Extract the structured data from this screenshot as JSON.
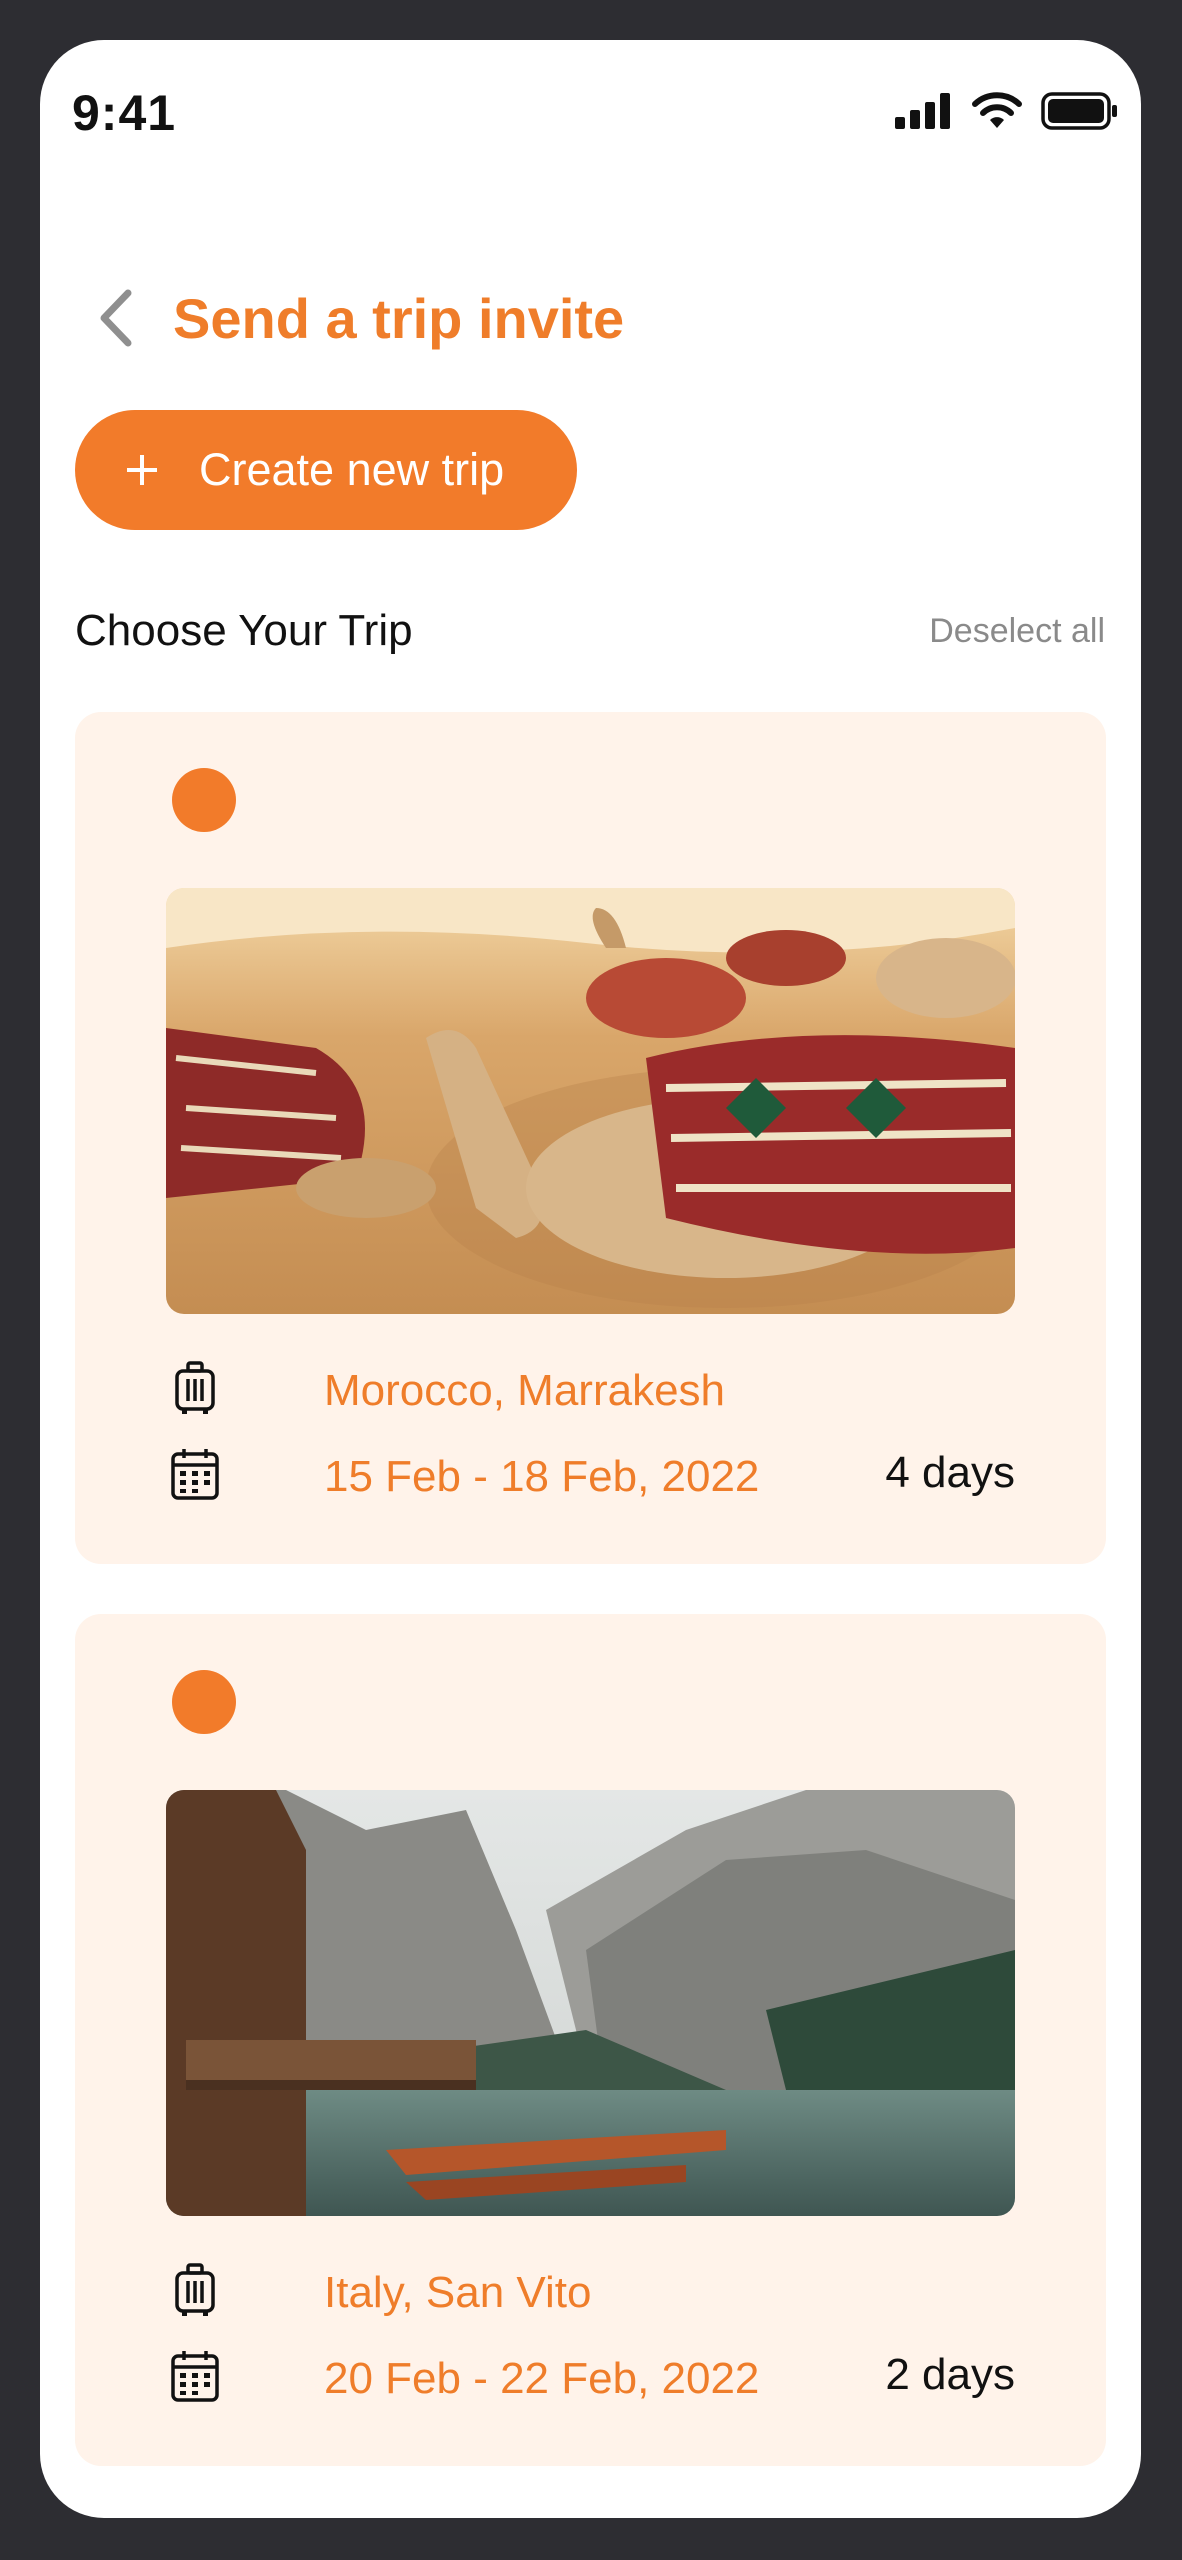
{
  "status_bar": {
    "time": "9:41",
    "icons": [
      "cellular-signal-icon",
      "wifi-icon",
      "battery-icon"
    ]
  },
  "header": {
    "back_icon": "chevron-left-icon",
    "title": "Send a trip invite"
  },
  "create_button": {
    "icon": "plus-icon",
    "label": "Create new trip"
  },
  "section": {
    "title": "Choose Your Trip",
    "deselect_label": "Deselect all"
  },
  "trips": [
    {
      "image": "desert-camels-photo",
      "location_icon": "suitcase-icon",
      "location": "Morocco, Marrakesh",
      "date_icon": "calendar-icon",
      "dates": "15 Feb - 18 Feb, 2022",
      "duration": "4 days",
      "selected": true
    },
    {
      "image": "mountain-lake-photo",
      "location_icon": "suitcase-icon",
      "location": "Italy, San Vito",
      "date_icon": "calendar-icon",
      "dates": "20 Feb - 22 Feb, 2022",
      "duration": "2 days",
      "selected": true
    }
  ],
  "colors": {
    "accent": "#f27b2a",
    "card_background": "#fff3ea",
    "device_frame": "#2d2d32",
    "muted_text": "#8a8a8a"
  }
}
